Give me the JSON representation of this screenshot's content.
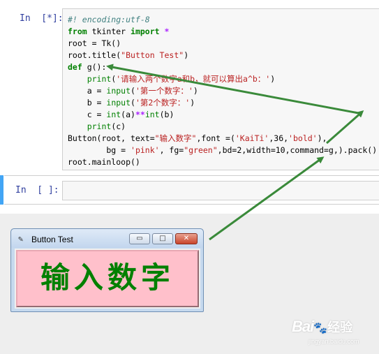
{
  "notebook": {
    "cell1": {
      "prompt": "In  [*]:",
      "code_lines": [
        [
          {
            "t": "#! encoding:utf-8",
            "c": "com"
          }
        ],
        [
          {
            "t": "from",
            "c": "kw"
          },
          {
            "t": " tkinter "
          },
          {
            "t": "import",
            "c": "kw"
          },
          {
            "t": " "
          },
          {
            "t": "*",
            "c": "op"
          }
        ],
        [
          {
            "t": "root = Tk()"
          }
        ],
        [
          {
            "t": "root.title("
          },
          {
            "t": "\"Button Test\"",
            "c": "str"
          },
          {
            "t": ")"
          }
        ],
        [
          {
            "t": "def",
            "c": "kw"
          },
          {
            "t": " g():"
          }
        ],
        [
          {
            "t": "    "
          },
          {
            "t": "print",
            "c": "bi"
          },
          {
            "t": "("
          },
          {
            "t": "'请输入两个数字a和b，就可以算出a^b：'",
            "c": "str"
          },
          {
            "t": ")"
          }
        ],
        [
          {
            "t": "    a = "
          },
          {
            "t": "input",
            "c": "bi"
          },
          {
            "t": "("
          },
          {
            "t": "'第一个数字：'",
            "c": "str"
          },
          {
            "t": ")"
          }
        ],
        [
          {
            "t": "    b = "
          },
          {
            "t": "input",
            "c": "bi"
          },
          {
            "t": "("
          },
          {
            "t": "'第2个数字：'",
            "c": "str"
          },
          {
            "t": ")"
          }
        ],
        [
          {
            "t": "    c = "
          },
          {
            "t": "int",
            "c": "bi"
          },
          {
            "t": "(a)"
          },
          {
            "t": "**",
            "c": "op"
          },
          {
            "t": "int",
            "c": "bi"
          },
          {
            "t": "(b)"
          }
        ],
        [
          {
            "t": "    "
          },
          {
            "t": "print",
            "c": "bi"
          },
          {
            "t": "(c)"
          }
        ],
        [
          {
            "t": "Button(root, text="
          },
          {
            "t": "\"输入数字\"",
            "c": "str"
          },
          {
            "t": ",font =("
          },
          {
            "t": "'KaiTi'",
            "c": "str"
          },
          {
            "t": ",36,"
          },
          {
            "t": "'bold'",
            "c": "str"
          },
          {
            "t": "),"
          }
        ],
        [
          {
            "t": "        bg = "
          },
          {
            "t": "'pink'",
            "c": "str"
          },
          {
            "t": ", fg="
          },
          {
            "t": "\"green\"",
            "c": "str"
          },
          {
            "t": ",bd=2,width=10,command=g,).pack()"
          }
        ],
        [
          {
            "t": "root.mainloop()"
          }
        ]
      ]
    },
    "cell2": {
      "prompt": "In  [ ]:",
      "value": ""
    }
  },
  "tk_window": {
    "title": "Button Test",
    "feather_icon": "feather-icon",
    "minimize_glyph": "▭",
    "maximize_glyph": "□",
    "close_glyph": "✕",
    "button_text": "输入数字",
    "button_bg": "#ffc0cb",
    "button_fg": "#008000"
  },
  "annotation": {
    "arrow_color": "#3a8a3a"
  },
  "watermark": {
    "logo": "Bai",
    "brand": "经验",
    "url": "jingyan.baidu.com"
  }
}
